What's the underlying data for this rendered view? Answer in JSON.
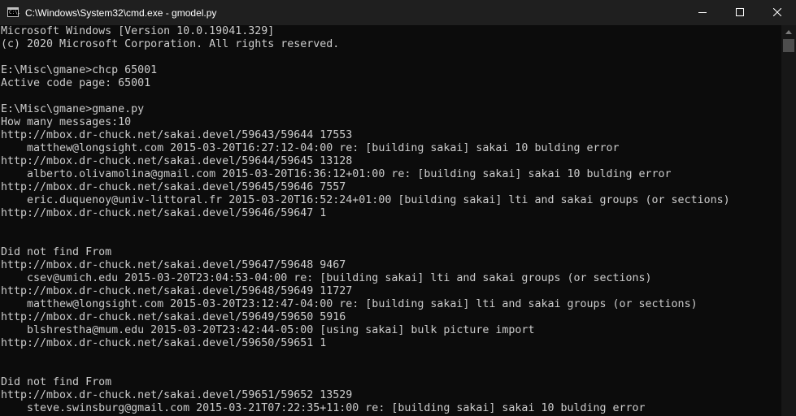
{
  "window": {
    "title": "C:\\Windows\\System32\\cmd.exe - gmodel.py",
    "icon": "cmd-icon",
    "icon_text": "C:\\."
  },
  "controls": {
    "minimize": "minimize-icon",
    "maximize": "maximize-icon",
    "close": "close-icon"
  },
  "console": {
    "lines": [
      "Microsoft Windows [Version 10.0.19041.329]",
      "(c) 2020 Microsoft Corporation. All rights reserved.",
      "",
      "E:\\Misc\\gmane>chcp 65001",
      "Active code page: 65001",
      "",
      "E:\\Misc\\gmane>gmane.py",
      "How many messages:10",
      "http://mbox.dr-chuck.net/sakai.devel/59643/59644 17553",
      "    matthew@longsight.com 2015-03-20T16:27:12-04:00 re: [building sakai] sakai 10 bulding error",
      "http://mbox.dr-chuck.net/sakai.devel/59644/59645 13128",
      "    alberto.olivamolina@gmail.com 2015-03-20T16:36:12+01:00 re: [building sakai] sakai 10 bulding error",
      "http://mbox.dr-chuck.net/sakai.devel/59645/59646 7557",
      "    eric.duquenoy@univ-littoral.fr 2015-03-20T16:52:24+01:00 [building sakai] lti and sakai groups (or sections)",
      "http://mbox.dr-chuck.net/sakai.devel/59646/59647 1",
      "",
      "",
      "Did not find From",
      "http://mbox.dr-chuck.net/sakai.devel/59647/59648 9467",
      "    csev@umich.edu 2015-03-20T23:04:53-04:00 re: [building sakai] lti and sakai groups (or sections)",
      "http://mbox.dr-chuck.net/sakai.devel/59648/59649 11727",
      "    matthew@longsight.com 2015-03-20T23:12:47-04:00 re: [building sakai] lti and sakai groups (or sections)",
      "http://mbox.dr-chuck.net/sakai.devel/59649/59650 5916",
      "    blshrestha@mum.edu 2015-03-20T23:42:44-05:00 [using sakai] bulk picture import",
      "http://mbox.dr-chuck.net/sakai.devel/59650/59651 1",
      "",
      "",
      "Did not find From",
      "http://mbox.dr-chuck.net/sakai.devel/59651/59652 13529",
      "    steve.swinsburg@gmail.com 2015-03-21T07:22:35+11:00 re: [building sakai] sakai 10 bulding error"
    ]
  },
  "scrollbar": {
    "up_arrow": "scroll-up-arrow-icon"
  },
  "colors": {
    "background": "#0c0c0c",
    "text": "#cccccc",
    "titlebar": "#1f1f1f"
  }
}
